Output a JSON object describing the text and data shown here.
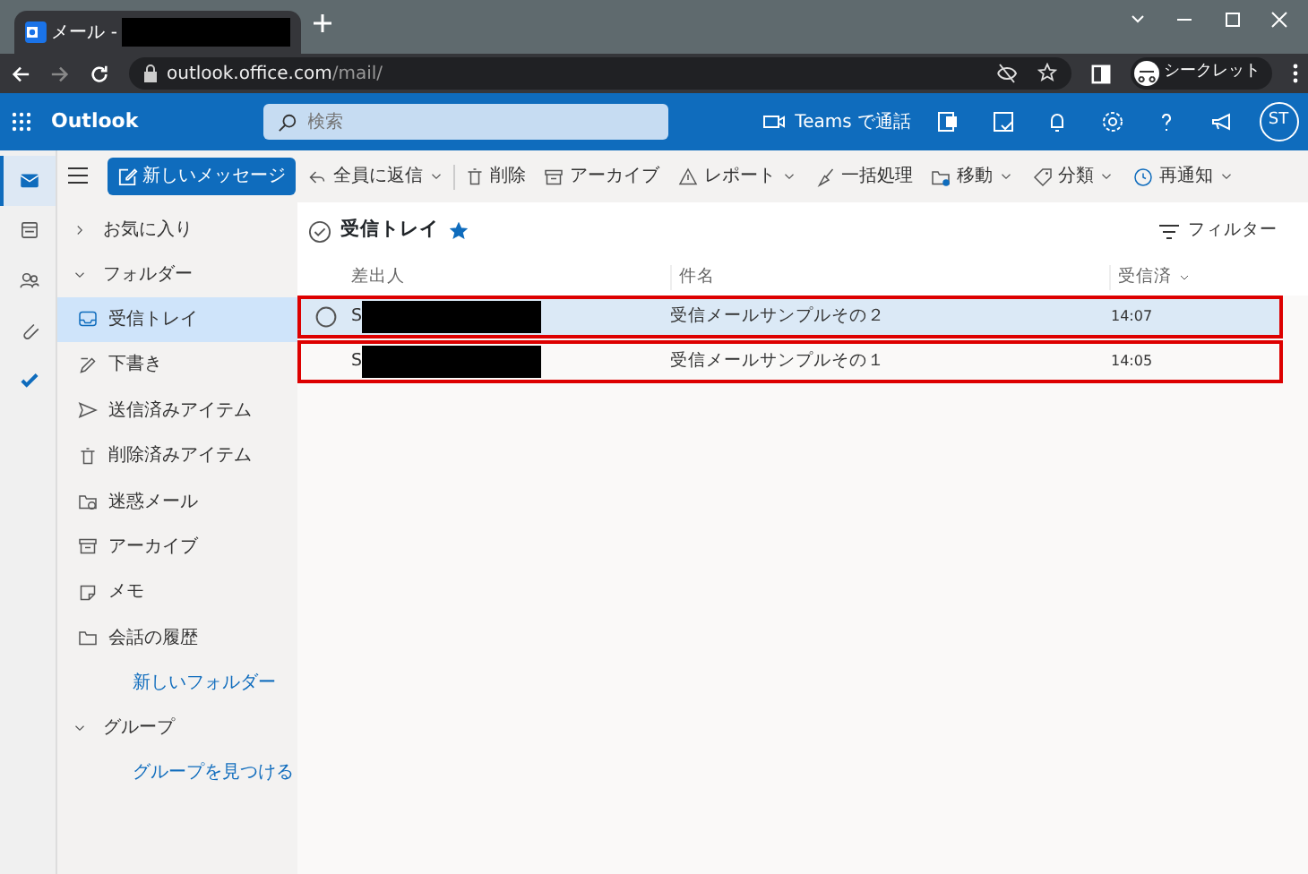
{
  "browser": {
    "tab_title": "メール -",
    "url_host": "outlook.office.com",
    "url_path": "/mail/",
    "profile": "シークレット"
  },
  "app": {
    "name": "Outlook",
    "search": {
      "placeholder": "検索"
    },
    "teams_call": "Teams で通話",
    "avatar": "ST"
  },
  "rail": [
    {
      "kind": "mail",
      "selected": true
    },
    {
      "kind": "calendar",
      "selected": false
    },
    {
      "kind": "people",
      "selected": false
    },
    {
      "kind": "files",
      "selected": false
    },
    {
      "kind": "todo",
      "selected": false
    }
  ],
  "new_message": "新しいメッセージ",
  "toolbar": [
    {
      "kind": "reply",
      "label": "全員に返信",
      "dropdown": true
    },
    {
      "kind": "trash",
      "label": "削除",
      "dropdown": false
    },
    {
      "kind": "archive",
      "label": "アーカイブ",
      "dropdown": false
    },
    {
      "kind": "report",
      "label": "レポート",
      "dropdown": true
    },
    {
      "kind": "sweep",
      "label": "一括処理",
      "dropdown": false
    },
    {
      "kind": "move",
      "label": "移動",
      "dropdown": true
    },
    {
      "kind": "tag",
      "label": "分類",
      "dropdown": true
    },
    {
      "kind": "clock",
      "label": "再通知",
      "dropdown": true
    }
  ],
  "nav": {
    "favorites": {
      "label": "お気に入り",
      "expanded": false
    },
    "folders": {
      "label": "フォルダー",
      "expanded": true,
      "items": [
        {
          "kind": "inbox",
          "label": "受信トレイ",
          "selected": true
        },
        {
          "kind": "draft",
          "label": "下書き",
          "selected": false
        },
        {
          "kind": "sent",
          "label": "送信済みアイテム",
          "selected": false
        },
        {
          "kind": "trash",
          "label": "削除済みアイテム",
          "selected": false
        },
        {
          "kind": "junk",
          "label": "迷惑メール",
          "selected": false
        },
        {
          "kind": "archive",
          "label": "アーカイブ",
          "selected": false
        },
        {
          "kind": "note",
          "label": "メモ",
          "selected": false
        },
        {
          "kind": "folder",
          "label": "会話の履歴",
          "selected": false
        }
      ],
      "new_folder": "新しいフォルダー"
    },
    "groups": {
      "label": "グループ",
      "expanded": true,
      "find": "グループを見つける"
    }
  },
  "list": {
    "title": "受信トレイ",
    "favorite": true,
    "filter": "フィルター",
    "columns": [
      "差出人",
      "件名",
      "受信済"
    ],
    "rows": [
      {
        "sender": "S",
        "subject": "受信メールサンプルその２",
        "time": "14:07",
        "selected": true
      },
      {
        "sender": "S",
        "subject": "受信メールサンプルその１",
        "time": "14:05",
        "selected": false
      }
    ]
  }
}
